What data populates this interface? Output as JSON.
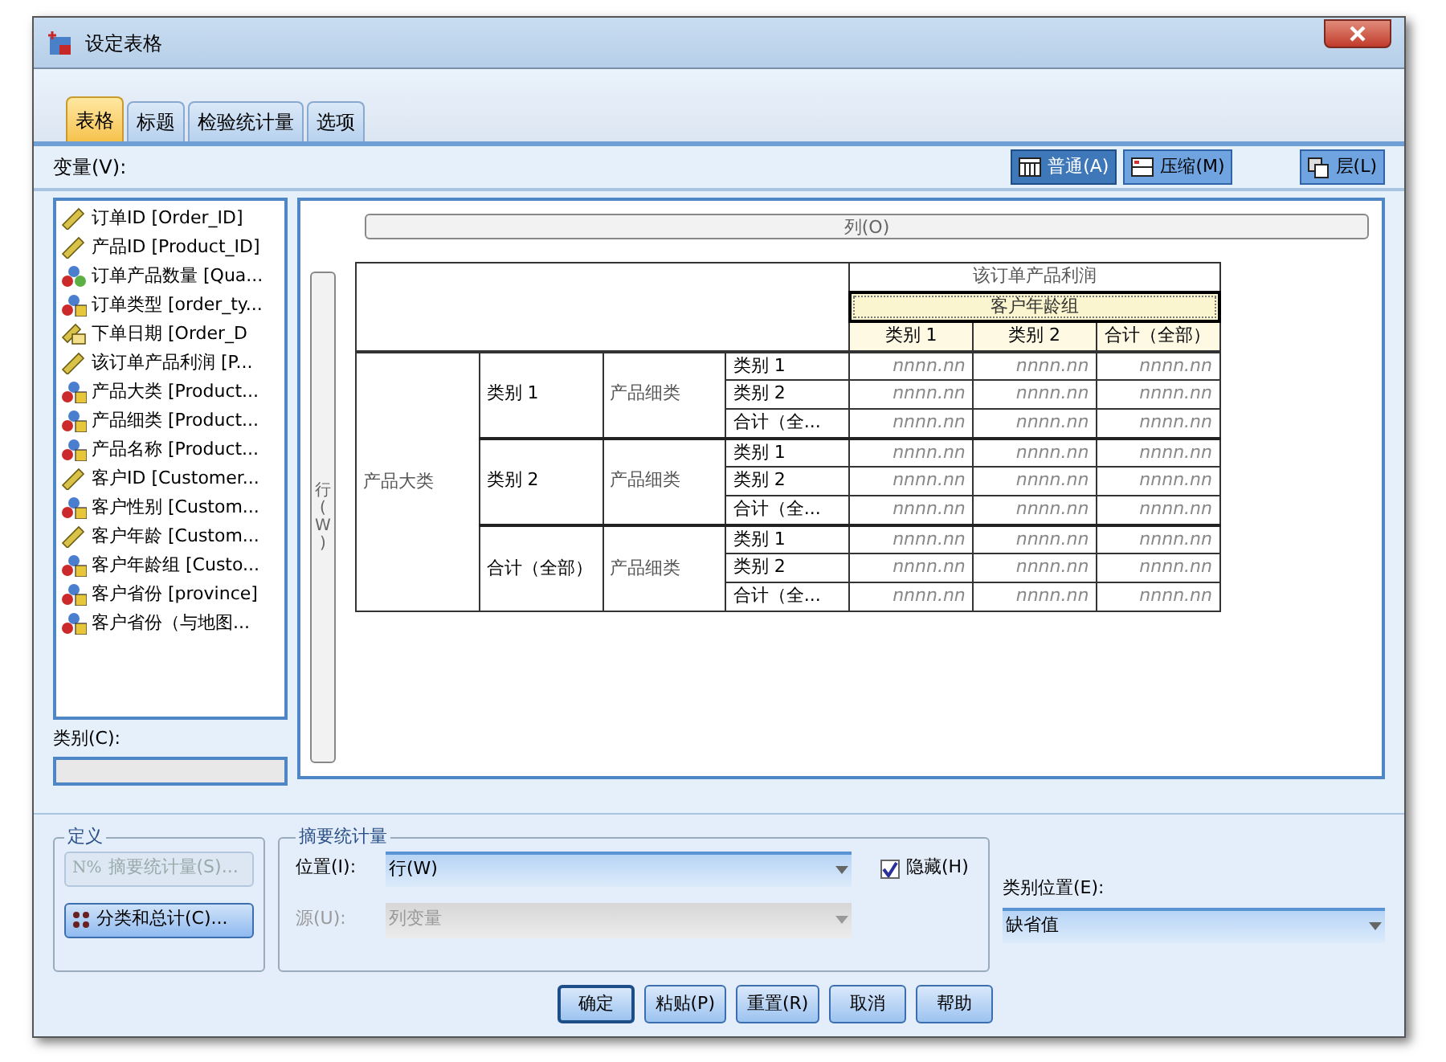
{
  "window": {
    "title": "设定表格"
  },
  "tabs": [
    {
      "label": "表格",
      "selected": true
    },
    {
      "label": "标题",
      "selected": false
    },
    {
      "label": "检验统计量",
      "selected": false
    },
    {
      "label": "选项",
      "selected": false
    }
  ],
  "view_buttons": [
    {
      "label": "普通(A)",
      "kind": "normal",
      "selected": true
    },
    {
      "label": "压缩(M)",
      "kind": "compact",
      "selected": false
    }
  ],
  "layers_button": {
    "label": "层(L)"
  },
  "variables": {
    "label": "变量(V):",
    "items": [
      {
        "name": "订单ID [Order_ID]",
        "kind": "scale"
      },
      {
        "name": "产品ID [Product_ID]",
        "kind": "scale"
      },
      {
        "name": "订单产品数量 [Qua...",
        "kind": "nominal"
      },
      {
        "name": "订单类型 [order_ty...",
        "kind": "nominal_string"
      },
      {
        "name": "下单日期 [Order_D",
        "kind": "date"
      },
      {
        "name": "该订单产品利润 [P...",
        "kind": "scale"
      },
      {
        "name": "产品大类 [Product...",
        "kind": "nominal_string"
      },
      {
        "name": "产品细类 [Product...",
        "kind": "nominal_string"
      },
      {
        "name": "产品名称 [Product...",
        "kind": "nominal_string"
      },
      {
        "name": "客户ID [Customer...",
        "kind": "scale"
      },
      {
        "name": "客户性别 [Custom...",
        "kind": "nominal_string"
      },
      {
        "name": "客户年龄 [Custom...",
        "kind": "scale"
      },
      {
        "name": "客户年龄组 [Custo...",
        "kind": "nominal_string"
      },
      {
        "name": "客户省份 [province]",
        "kind": "nominal_string"
      },
      {
        "name": "客户省份（与地图...",
        "kind": "nominal_string"
      }
    ]
  },
  "categories": {
    "label": "类别(C):"
  },
  "canvas": {
    "columns_label": "列(O)",
    "rows_label": "行(W)",
    "table": {
      "column_variable": "该订单产品利润",
      "column_group": {
        "label": "客户年龄组",
        "selected": true
      },
      "column_categories": [
        "类别 1",
        "类别 2",
        "合计（全部）"
      ],
      "row_variable": "产品大类",
      "groups": [
        {
          "label": "类别 1",
          "sub_variable": "产品细类",
          "subrows": [
            {
              "label": "类别 1",
              "cells": [
                "nnnn.nn",
                "nnnn.nn",
                "nnnn.nn"
              ]
            },
            {
              "label": "类别 2",
              "cells": [
                "nnnn.nn",
                "nnnn.nn",
                "nnnn.nn"
              ]
            },
            {
              "label": "合计（全...",
              "cells": [
                "nnnn.nn",
                "nnnn.nn",
                "nnnn.nn"
              ]
            }
          ]
        },
        {
          "label": "类别 2",
          "sub_variable": "产品细类",
          "subrows": [
            {
              "label": "类别 1",
              "cells": [
                "nnnn.nn",
                "nnnn.nn",
                "nnnn.nn"
              ]
            },
            {
              "label": "类别 2",
              "cells": [
                "nnnn.nn",
                "nnnn.nn",
                "nnnn.nn"
              ]
            },
            {
              "label": "合计（全...",
              "cells": [
                "nnnn.nn",
                "nnnn.nn",
                "nnnn.nn"
              ]
            }
          ]
        },
        {
          "label": "合计（全部）",
          "sub_variable": "产品细类",
          "subrows": [
            {
              "label": "类别 1",
              "cells": [
                "nnnn.nn",
                "nnnn.nn",
                "nnnn.nn"
              ]
            },
            {
              "label": "类别 2",
              "cells": [
                "nnnn.nn",
                "nnnn.nn",
                "nnnn.nn"
              ]
            },
            {
              "label": "合计（全...",
              "cells": [
                "nnnn.nn",
                "nnnn.nn",
                "nnnn.nn"
              ]
            }
          ]
        }
      ]
    }
  },
  "define": {
    "label": "定义",
    "buttons": [
      {
        "label": "摘要统计量(S)...",
        "kind": "summary",
        "icon_text": "N%",
        "disabled": true
      },
      {
        "label": "分类和总计(C)...",
        "kind": "categories",
        "disabled": false
      }
    ]
  },
  "summary_statistics": {
    "label": "摘要统计量",
    "position": {
      "label": "位置(I):",
      "value": "行(W)",
      "disabled": false
    },
    "hide": {
      "label": "隐藏(H)",
      "checked": true
    },
    "source": {
      "label": "源(U):",
      "value": "列变量",
      "disabled": true
    }
  },
  "category_position": {
    "label": "类别位置(E):",
    "value": "缺省值"
  },
  "buttons": [
    {
      "label": "确定",
      "default": true
    },
    {
      "label": "粘贴(P)",
      "default": false
    },
    {
      "label": "重置(R)",
      "default": false
    },
    {
      "label": "取消",
      "default": false
    },
    {
      "label": "帮助",
      "default": false
    }
  ]
}
